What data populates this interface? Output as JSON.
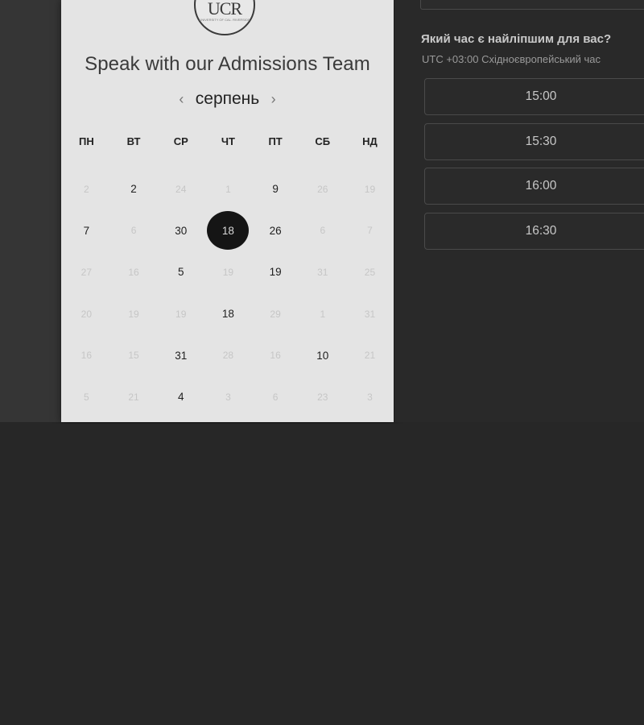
{
  "logo": {
    "text": "UCR",
    "subtext": "UNIVERSITY OF CAL. RIVERSIDE"
  },
  "calendar": {
    "title": "Speak with our Admissions Team",
    "month": "серпень",
    "prev_icon": "chevron-left-icon",
    "next_icon": "chevron-right-icon",
    "weekdays": [
      "ПН",
      "ВТ",
      "СР",
      "ЧТ",
      "ПТ",
      "СБ",
      "НД"
    ],
    "rows": [
      [
        {
          "d": "2",
          "m": true
        },
        {
          "d": "2",
          "m": false
        },
        {
          "d": "24",
          "m": true
        },
        {
          "d": "1",
          "m": true
        },
        {
          "d": "9",
          "m": false
        },
        {
          "d": "26",
          "m": true
        },
        {
          "d": "19",
          "m": true
        }
      ],
      [
        {
          "d": "7",
          "m": false
        },
        {
          "d": "6",
          "m": true
        },
        {
          "d": "30",
          "m": false
        },
        {
          "d": "18",
          "m": false,
          "sel": true
        },
        {
          "d": "26",
          "m": false
        },
        {
          "d": "6",
          "m": true
        },
        {
          "d": "7",
          "m": true
        }
      ],
      [
        {
          "d": "27",
          "m": true
        },
        {
          "d": "16",
          "m": true
        },
        {
          "d": "5",
          "m": false
        },
        {
          "d": "19",
          "m": true
        },
        {
          "d": "19",
          "m": false
        },
        {
          "d": "31",
          "m": true
        },
        {
          "d": "25",
          "m": true
        }
      ],
      [
        {
          "d": "20",
          "m": true
        },
        {
          "d": "19",
          "m": true
        },
        {
          "d": "19",
          "m": true
        },
        {
          "d": "18",
          "m": false
        },
        {
          "d": "29",
          "m": true
        },
        {
          "d": "1",
          "m": true
        },
        {
          "d": "31",
          "m": true
        }
      ],
      [
        {
          "d": "16",
          "m": true
        },
        {
          "d": "15",
          "m": true
        },
        {
          "d": "31",
          "m": false
        },
        {
          "d": "28",
          "m": true
        },
        {
          "d": "16",
          "m": true
        },
        {
          "d": "10",
          "m": false
        },
        {
          "d": "21",
          "m": true
        }
      ],
      [
        {
          "d": "5",
          "m": true
        },
        {
          "d": "21",
          "m": true
        },
        {
          "d": "4",
          "m": false
        },
        {
          "d": "3",
          "m": true
        },
        {
          "d": "6",
          "m": true
        },
        {
          "d": "23",
          "m": true
        },
        {
          "d": "3",
          "m": true
        }
      ]
    ]
  },
  "time_panel": {
    "question": "Який час є найліпшим для вас?",
    "timezone": "UTC +03:00 Східноєвропейський час",
    "slots": [
      "15:00",
      "15:30",
      "16:00",
      "16:30"
    ]
  }
}
